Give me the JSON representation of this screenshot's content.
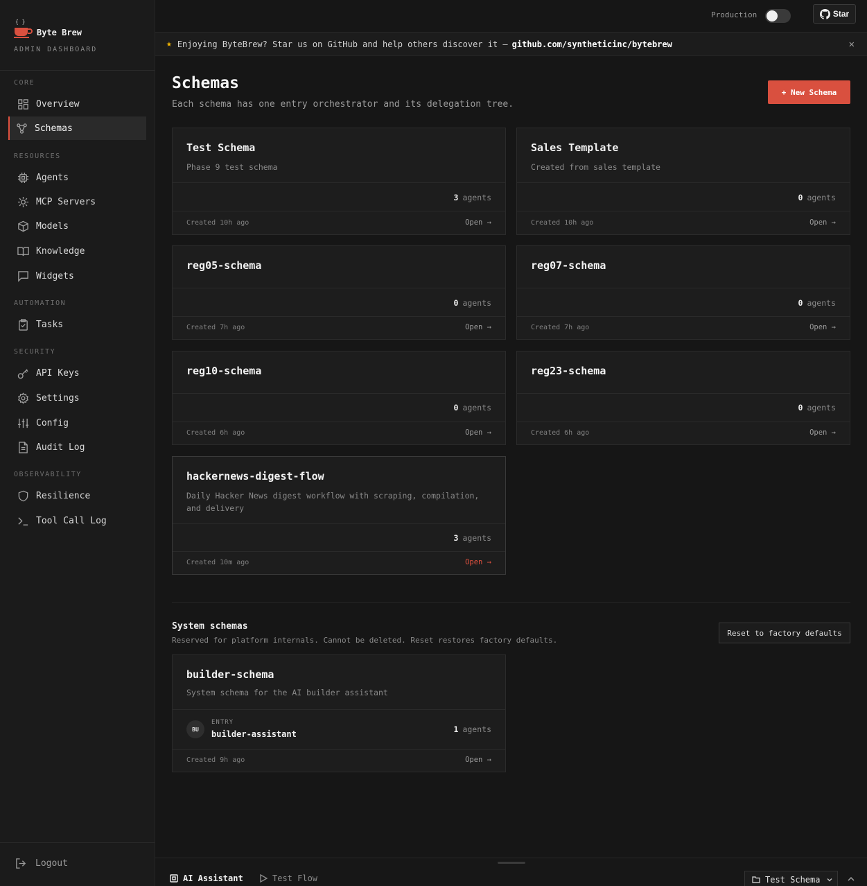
{
  "brand": {
    "name": "Byte Brew",
    "subtitle": "ADMIN DASHBOARD",
    "accent": "#d9503f"
  },
  "sidebar": {
    "sections": {
      "core": "CORE",
      "resources": "RESOURCES",
      "automation": "AUTOMATION",
      "security": "SECURITY",
      "observability": "OBSERVABILITY"
    },
    "items": {
      "overview": "Overview",
      "schemas": "Schemas",
      "agents": "Agents",
      "mcp_servers": "MCP Servers",
      "models": "Models",
      "knowledge": "Knowledge",
      "widgets": "Widgets",
      "tasks": "Tasks",
      "api_keys": "API Keys",
      "settings": "Settings",
      "config": "Config",
      "audit_log": "Audit Log",
      "resilience": "Resilience",
      "tool_call_log": "Tool Call Log"
    },
    "active": "schemas",
    "logout": "Logout"
  },
  "topbar": {
    "env_label": "Production",
    "env_enabled": false,
    "star_label": "Star"
  },
  "banner": {
    "text": "Enjoying ByteBrew? Star us on GitHub and help others discover it —",
    "link": "github.com/syntheticinc/bytebrew"
  },
  "page": {
    "title": "Schemas",
    "subtitle": "Each schema has one entry orchestrator and its delegation tree.",
    "new_button": "+ New Schema"
  },
  "agents_word": "agents",
  "open_label": "Open →",
  "schemas": [
    {
      "name": "Test Schema",
      "description": "Phase 9 test schema",
      "agents": "3",
      "created": "Created 10h ago"
    },
    {
      "name": "Sales Template",
      "description": "Created from sales template",
      "agents": "0",
      "created": "Created 10h ago"
    },
    {
      "name": "reg05-schema",
      "description": "",
      "agents": "0",
      "created": "Created 7h ago"
    },
    {
      "name": "reg07-schema",
      "description": "",
      "agents": "0",
      "created": "Created 7h ago"
    },
    {
      "name": "reg10-schema",
      "description": "",
      "agents": "0",
      "created": "Created 6h ago"
    },
    {
      "name": "reg23-schema",
      "description": "",
      "agents": "0",
      "created": "Created 6h ago"
    },
    {
      "name": "hackernews-digest-flow",
      "description": "Daily Hacker News digest workflow with scraping, compilation, and delivery",
      "agents": "3",
      "created": "Created 10m ago"
    }
  ],
  "system": {
    "title": "System schemas",
    "subtitle": "Reserved for platform internals. Cannot be deleted. Reset restores factory defaults.",
    "reset_button": "Reset to factory defaults",
    "schema": {
      "name": "builder-schema",
      "description": "System schema for the AI builder assistant",
      "entry_label": "ENTRY",
      "entry_avatar": "BU",
      "entry_name": "builder-assistant",
      "agents": "1",
      "created": "Created 9h ago"
    }
  },
  "bottom": {
    "tab_ai": "AI Assistant",
    "tab_test": "Test Flow",
    "schema_select": "Test Schema"
  }
}
